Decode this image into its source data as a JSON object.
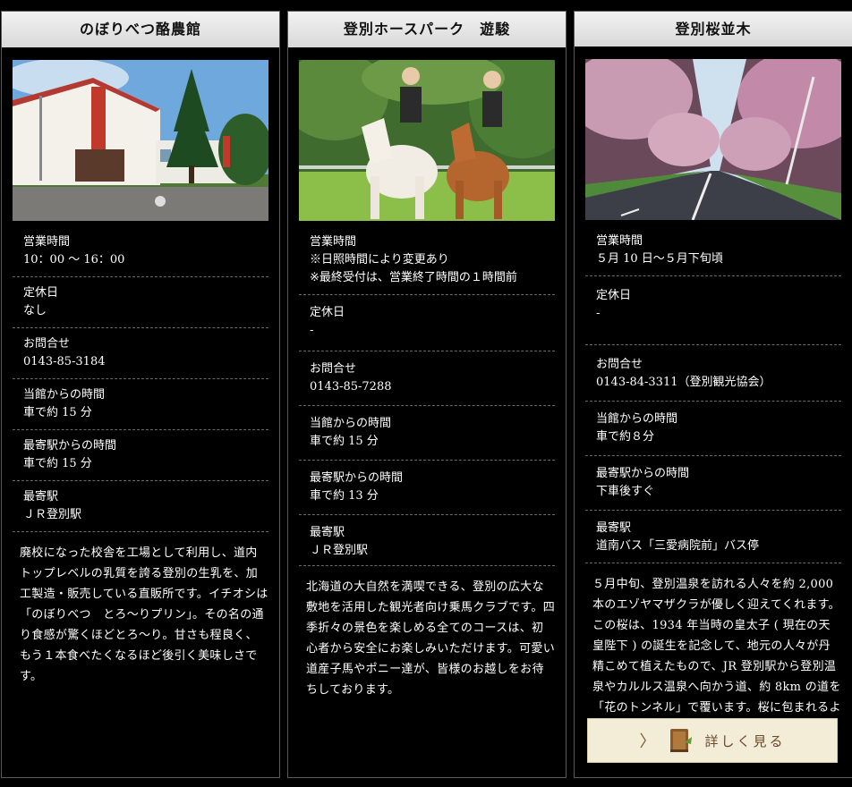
{
  "cards": [
    {
      "title": "のぼりべつ酪農館",
      "rows": [
        {
          "label": "営業時間",
          "value": "10：00 〜 16：00"
        },
        {
          "label": "定休日",
          "value": "なし"
        },
        {
          "label": "お問合せ",
          "value": "0143-85-3184"
        },
        {
          "label": "当館からの時間",
          "value": "車で約 15 分"
        },
        {
          "label": "最寄駅からの時間",
          "value": "車で約 15 分"
        },
        {
          "label": "最寄駅",
          "value": "ＪＲ登別駅"
        }
      ],
      "description": "廃校になった校舎を工場として利用し、道内トップレベルの乳質を誇る登別の生乳を、加工製造・販売している直販所です。イチオシは「のぼりべつ　とろ〜りプリン」。その名の通り食感が驚くほどとろ〜り。甘さも程良く、もう１本食べたくなるほど後引く美味しさです。"
    },
    {
      "title": "登別ホースパーク　遊駿",
      "rows": [
        {
          "label": "営業時間",
          "value": "※日照時間により変更あり\n※最終受付は、営業終了時間の１時間前"
        },
        {
          "label": "定休日",
          "value": "-"
        },
        {
          "label": "お問合せ",
          "value": "0143-85-7288"
        },
        {
          "label": "当館からの時間",
          "value": "車で約 15 分"
        },
        {
          "label": "最寄駅からの時間",
          "value": "車で約 13 分"
        },
        {
          "label": "最寄駅",
          "value": "ＪＲ登別駅"
        }
      ],
      "description": "北海道の大自然を満喫できる、登別の広大な敷地を活用した観光者向け乗馬クラブです。四季折々の景色を楽しめる全てのコースは、初心者から安全にお楽しみいただけます。可愛い道産子馬やポニー達が、皆様のお越しをお待ちしております。"
    },
    {
      "title": "登別桜並木",
      "rows": [
        {
          "label": "営業時間",
          "value": "５月 10 日〜５月下旬頃"
        },
        {
          "label": "定休日",
          "value": "-"
        },
        {
          "label": "お問合せ",
          "value": "0143-84-3311（登別観光協会）"
        },
        {
          "label": "当館からの時間",
          "value": "車で約８分"
        },
        {
          "label": "最寄駅からの時間",
          "value": "下車後すぐ"
        },
        {
          "label": "最寄駅",
          "value": "道南バス「三愛病院前」バス停"
        }
      ],
      "description": "５月中旬、登別温泉を訪れる人々を約 2,000 本のエゾヤマザクラが優しく迎えてくれます。この桜は、1934 年当時の皇太子 ( 現在の天皇陛下 ) の誕生を記念して、地元の人々が丹精こめて植えたもので、JR 登別駅から登別温泉やカルルス温泉へ向かう道、約 8km の道を「花のトンネル」で覆います。桜に包まれるような素敵な雰囲気を楽しむことができます。",
      "more_label": "詳しく見る",
      "more_icons": [
        "chevron-right-icon",
        "book-icon"
      ]
    }
  ],
  "colors": {
    "header_bg": "#e3e3e3",
    "button_bg": "#f3ecd7",
    "button_text": "#6b4a2b"
  }
}
